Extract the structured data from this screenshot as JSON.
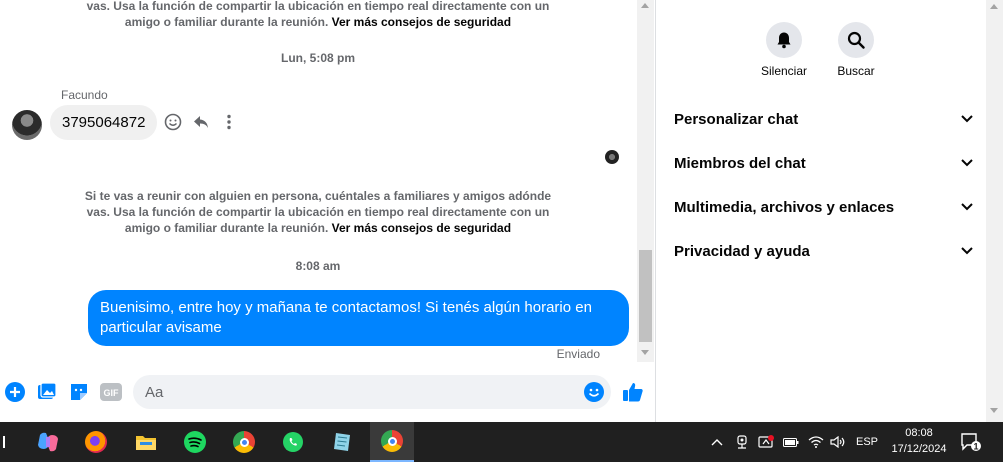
{
  "chat": {
    "notice_top_line1": "vas. Usa la función de compartir la ubicación en tiempo real directamente con un",
    "notice_top_line2": "amigo o familiar durante la reunión.",
    "notice_link": "Ver más consejos de seguridad",
    "timestamp_1": "Lun, 5:08 pm",
    "sender_name": "Facundo",
    "incoming_message": "3795064872",
    "notice_line1": "Si te vas a reunir con alguien en persona, cuéntales a familiares y amigos adónde",
    "notice_line2": "vas. Usa la función de compartir la ubicación en tiempo real directamente con un",
    "notice_line3": "amigo o familiar durante la reunión.",
    "timestamp_2": "8:08 am",
    "outgoing_message": "Buenisimo, entre hoy y mañana te contactamos! Si tenés algún horario en particular avisame",
    "delivery_status": "Enviado"
  },
  "composer": {
    "placeholder": "Aa",
    "value": "",
    "gif_label": "GIF"
  },
  "side_panel": {
    "quick_actions": [
      {
        "label": "Silenciar",
        "icon": "bell-icon"
      },
      {
        "label": "Buscar",
        "icon": "search-icon"
      }
    ],
    "sections": [
      {
        "label": "Personalizar chat"
      },
      {
        "label": "Miembros del chat"
      },
      {
        "label": "Multimedia, archivos y enlaces"
      },
      {
        "label": "Privacidad y ayuda"
      }
    ]
  },
  "taskbar": {
    "apps": [
      "copilot-icon",
      "firefox-icon",
      "file-explorer-icon",
      "spotify-icon",
      "chrome-icon",
      "whatsapp-icon",
      "notes-icon",
      "chrome-profile-icon"
    ],
    "language": "ESP",
    "time": "08:08",
    "date": "17/12/2024",
    "notification_count": "1"
  },
  "colors": {
    "messenger_blue": "#0084ff",
    "bubble_gray": "#f0f0f0",
    "taskbar_bg": "#202020"
  }
}
